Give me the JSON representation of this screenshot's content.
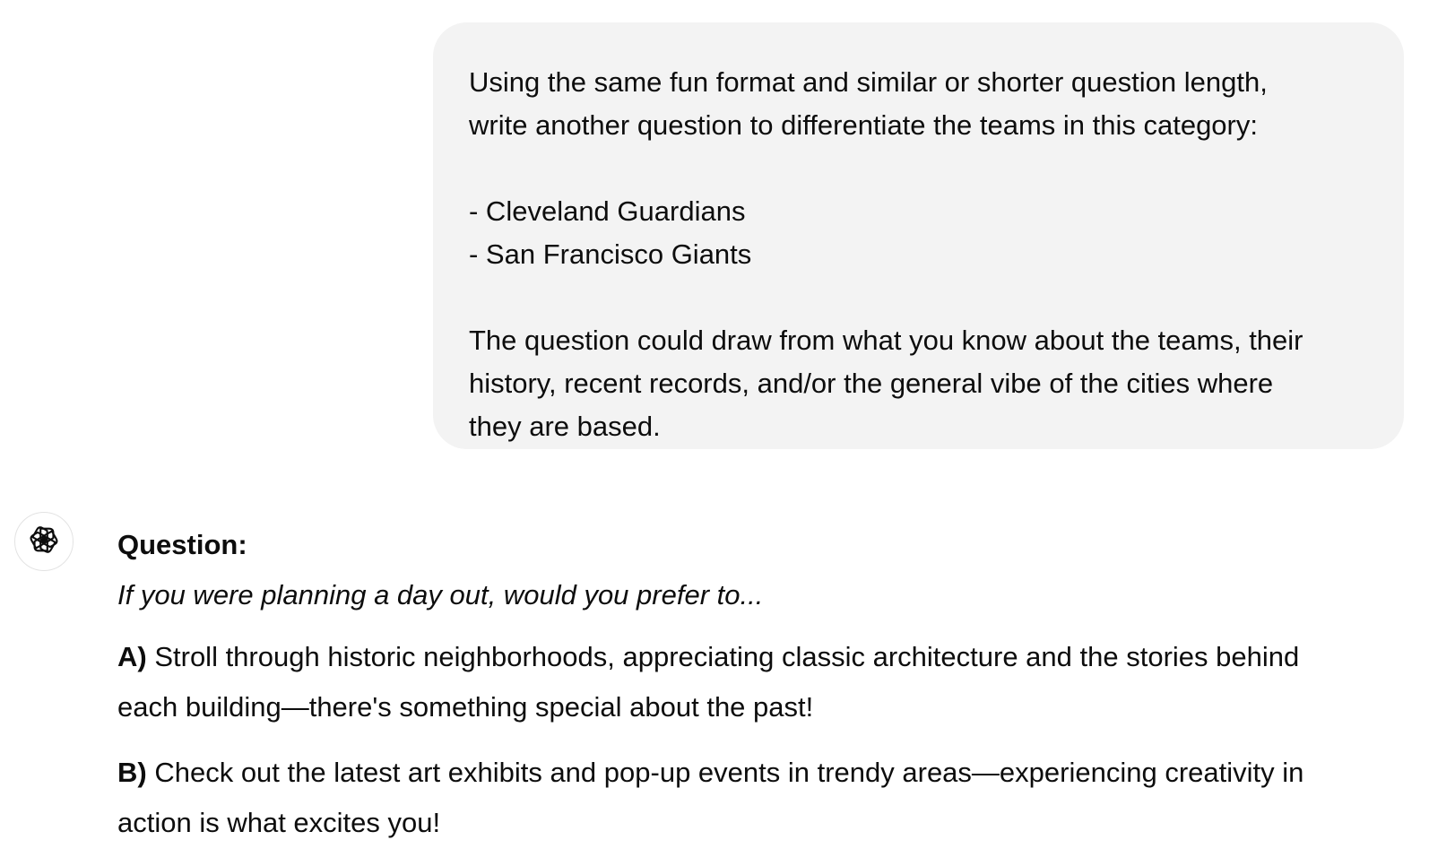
{
  "user_message": {
    "lines_1": [
      "Using the same fun format and similar or shorter question length,",
      "write another question to differentiate the teams in this category:"
    ],
    "teams": [
      "- Cleveland Guardians",
      "- San Francisco Giants"
    ],
    "lines_2": [
      "The question could draw from what you know about the teams, their",
      "history, recent records, and/or the general vibe of the cities where",
      "they are based."
    ]
  },
  "assistant": {
    "avatar_icon": "openai-logo-icon",
    "question_label": "Question:",
    "question_prompt": "If you were planning a day out, would you prefer to...",
    "option_a": {
      "key": "A)",
      "lines": [
        " Stroll through historic neighborhoods, appreciating classic architecture and the stories behind",
        "each building—there's something special about the past!"
      ]
    },
    "option_b": {
      "key": "B)",
      "lines": [
        " Check out the latest art exhibits and pop-up events in trendy areas—experiencing creativity in",
        "action is what excites you!"
      ]
    }
  },
  "colors": {
    "bubble_background": "#f3f3f3",
    "text": "#0d0d0d",
    "avatar_border": "#e3e3e3"
  }
}
